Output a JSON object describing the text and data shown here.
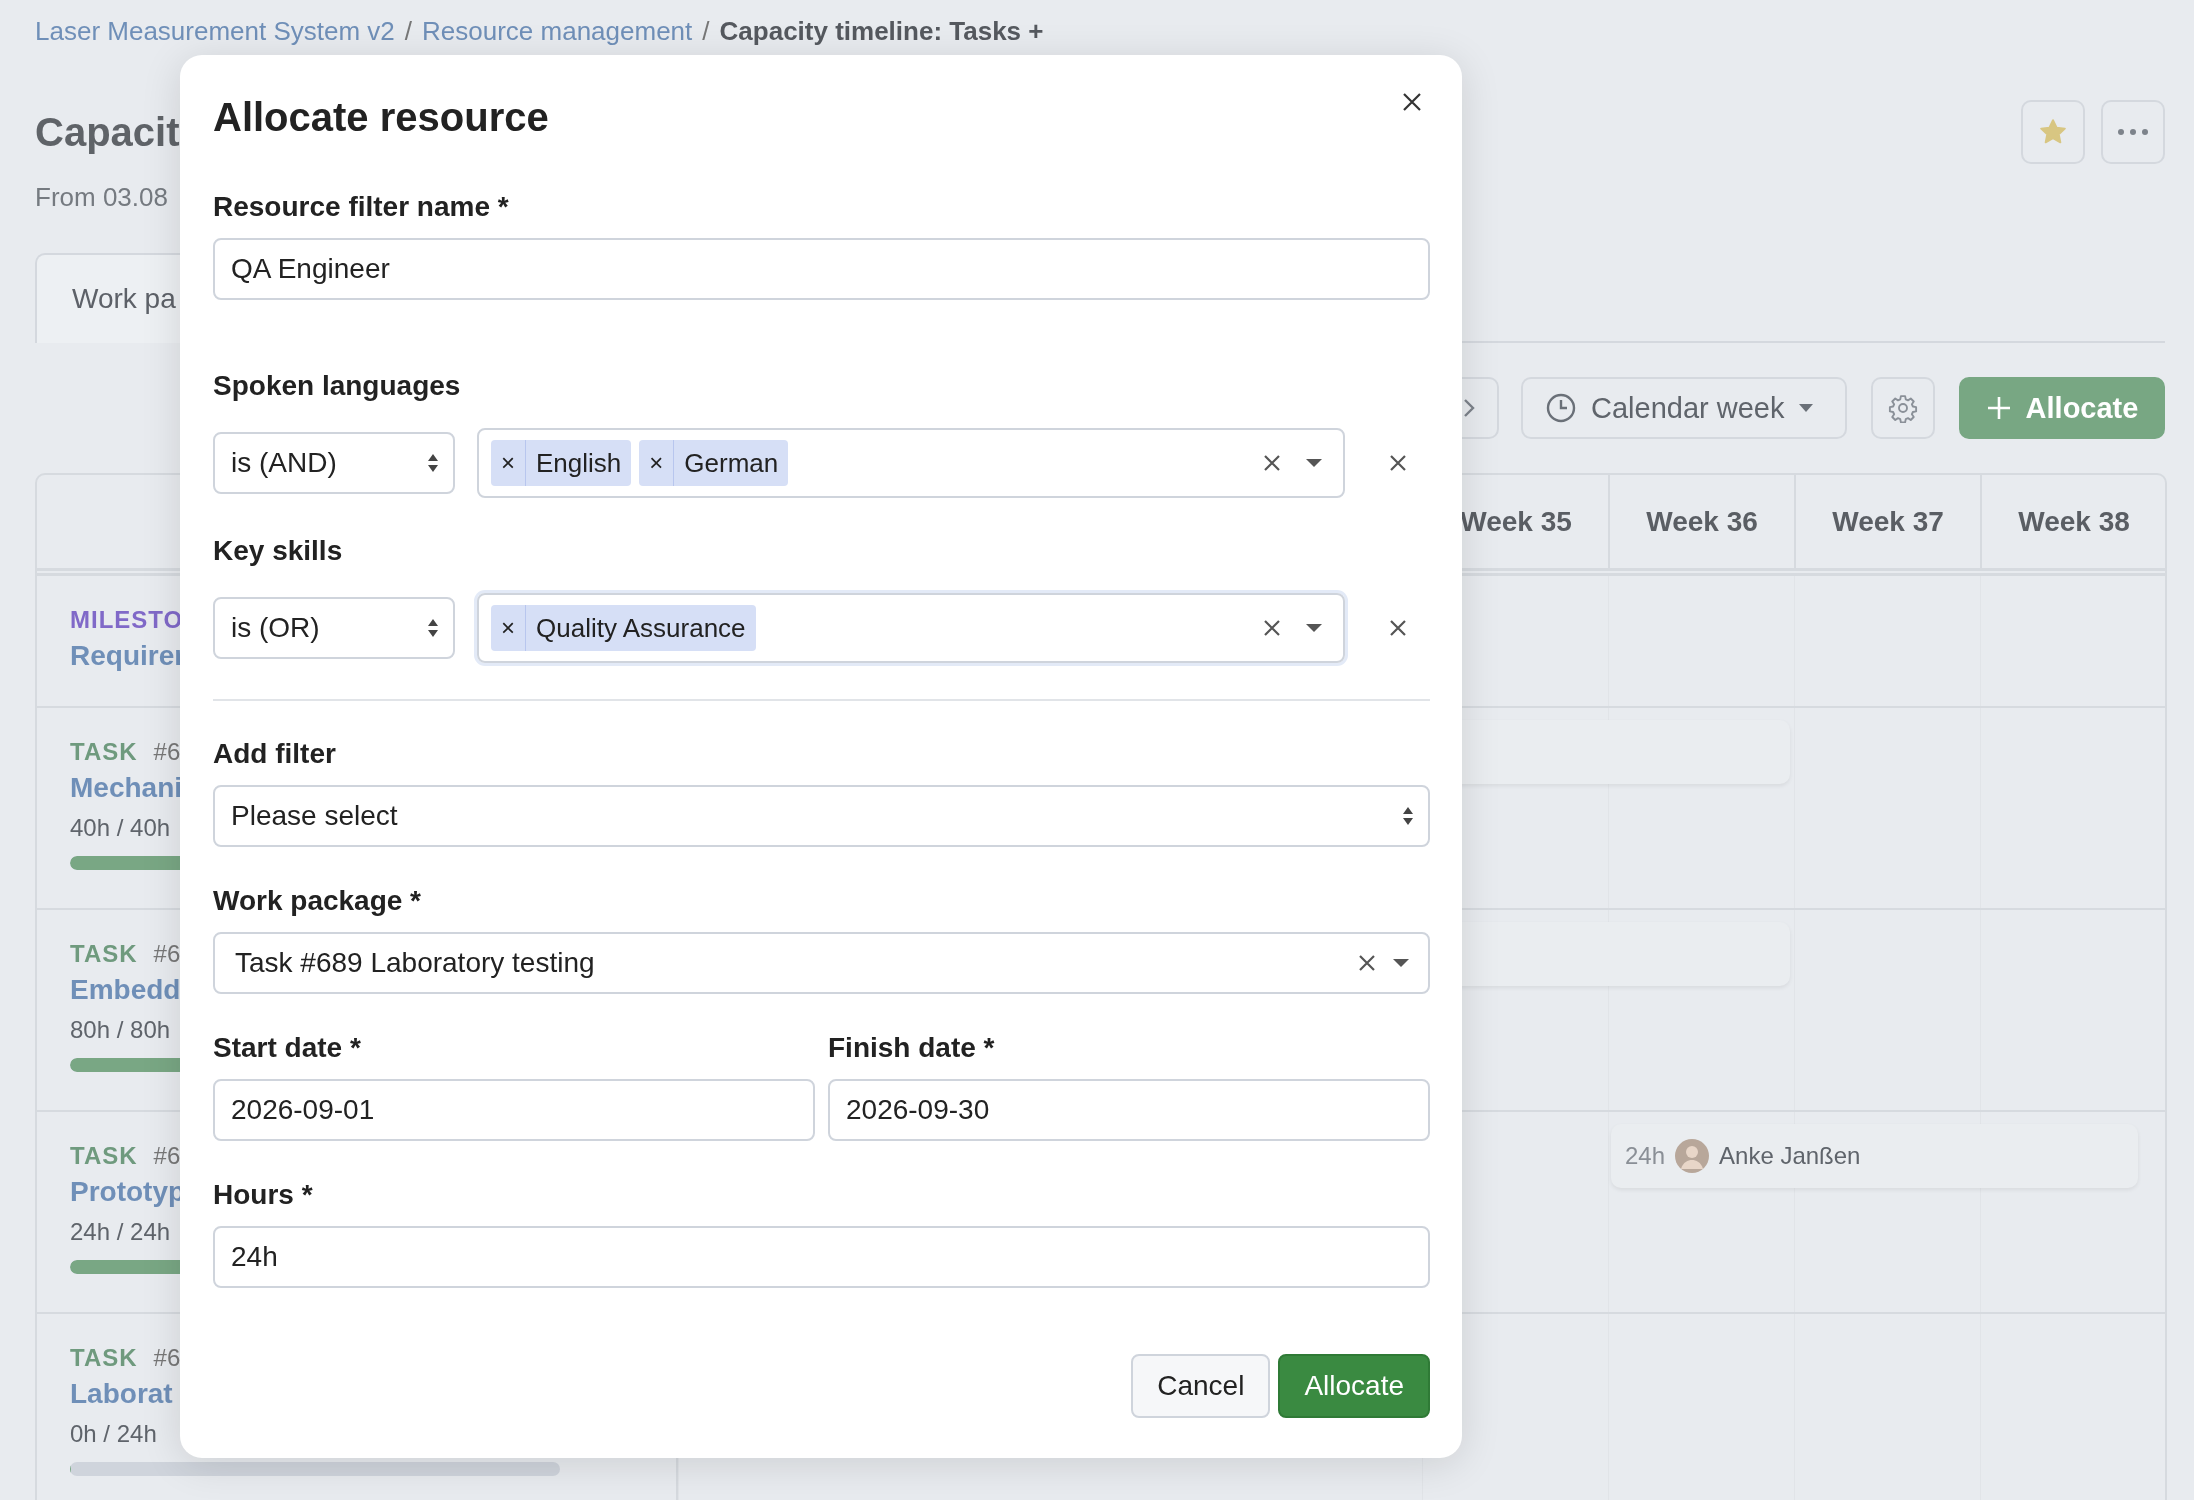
{
  "breadcrumb": {
    "separator": "/",
    "items": [
      {
        "label": "Laser Measurement System v2",
        "current": false
      },
      {
        "label": "Resource management",
        "current": false
      },
      {
        "label": "Capacity timeline: Tasks +",
        "current": true
      }
    ]
  },
  "page": {
    "title": "Capacit",
    "subtitle": "From 03.08",
    "favorite": true
  },
  "tabs": [
    {
      "label": "Work pa",
      "selected": true
    }
  ],
  "toolbar": {
    "view": "Calendar week",
    "allocate": "Allocate"
  },
  "timeline": {
    "weeks": [
      "Week 35",
      "Week 36",
      "Week 37",
      "Week 38"
    ],
    "rows": [
      {
        "kind": "milestone",
        "type": "MILESTO",
        "name": "Requirer"
      },
      {
        "kind": "task",
        "type": "TASK",
        "number": "#6",
        "name": "Mechani",
        "hours": "40h / 40h",
        "level": 1,
        "bar": {
          "kind": "plain"
        }
      },
      {
        "kind": "task",
        "type": "TASK",
        "number": "#6",
        "name": "Embedd",
        "hours": "80h / 80h",
        "level": 1,
        "bar": {
          "kind": "plain"
        }
      },
      {
        "kind": "task",
        "type": "TASK",
        "number": "#6",
        "name": "Prototyp",
        "hours": "24h / 24h",
        "level": 1,
        "bar": {
          "kind": "assigned",
          "hours": "24h",
          "assignee": "Anke Janßen"
        }
      },
      {
        "kind": "task",
        "type": "TASK",
        "number": "#6",
        "name": "Laborat",
        "hours": "0h / 24h",
        "level": 0
      }
    ]
  },
  "modal": {
    "title": "Allocate resource",
    "name_field": {
      "label": "Resource filter name *",
      "value": "QA Engineer"
    },
    "remove_glyph": "×",
    "filters": [
      {
        "label": "Spoken languages",
        "operator": "is (AND)",
        "values": [
          "English",
          "German"
        ],
        "focused": false
      },
      {
        "label": "Key skills",
        "operator": "is (OR)",
        "values": [
          "Quality Assurance"
        ],
        "focused": true
      }
    ],
    "add_filter": {
      "label": "Add filter",
      "value": "Please select"
    },
    "work_package": {
      "label": "Work package *",
      "value": "Task #689 Laboratory testing"
    },
    "start_date": {
      "label": "Start date *",
      "value": "2026-09-01"
    },
    "finish_date": {
      "label": "Finish date *",
      "value": "2026-09-30"
    },
    "hours": {
      "label": "Hours *",
      "value": "24h"
    },
    "buttons": {
      "cancel": "Cancel",
      "submit": "Allocate"
    }
  }
}
